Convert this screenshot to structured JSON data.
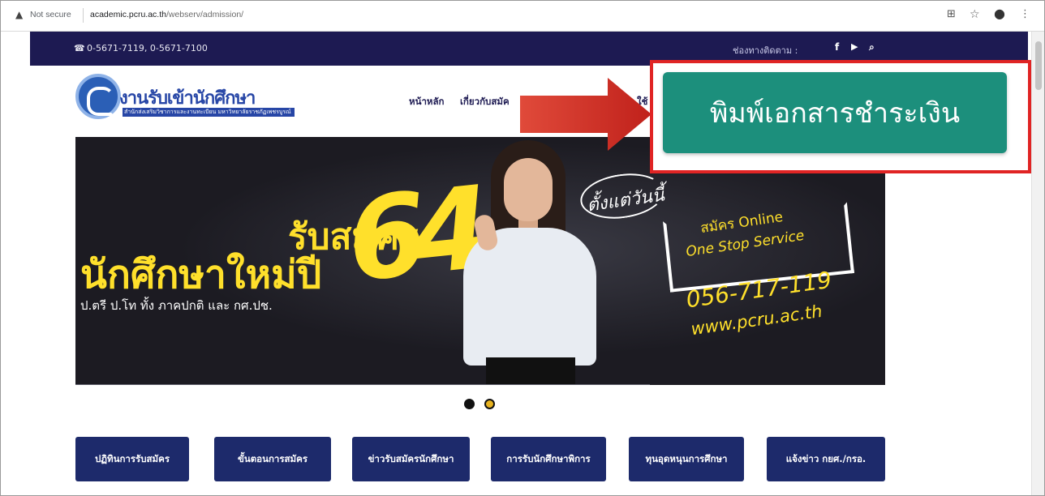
{
  "browser": {
    "security_warning": "Not secure",
    "url_host": "academic.pcru.ac.th",
    "url_path": "/webserv/admission/"
  },
  "topbar": {
    "phone": "0-5671-7119, 0-5671-7100",
    "follow_label": "ช่องทางติดตาม :"
  },
  "header": {
    "logo_title": "งานรับเข้านักศึกษา",
    "logo_subtitle": "สำนักส่งเสริมวิชาการและงานทะเบียน มหาวิทยาลัยราชภัฏเพชรบูรณ์",
    "nav": {
      "home": "หน้าหลัก",
      "apply": "เกี่ยวกับสมัค",
      "partial": "ใช้"
    }
  },
  "highlight": {
    "print_payment_button": "พิมพ์เอกสารชำระเงิน"
  },
  "banner": {
    "line1": "รับสมัคร",
    "line2": "นักศึกษาใหม่ปี",
    "year": "64",
    "line3": "ป.ตรี ป.โท ทั้ง ภาคปกติ และ กศ.ปช.",
    "since": "ตั้งแต่วันนี้",
    "online": "สมัคร Online",
    "service": "One Stop Service",
    "tel": "056-717-119",
    "web": "www.pcru.ac.th"
  },
  "quick_links": [
    "ปฏิทินการรับสมัคร",
    "ขั้นตอนการสมัคร",
    "ข่าวรับสมัครนักศึกษา",
    "การรับนักศึกษาพิการ",
    "ทุนอุดหนุนการศึกษา",
    "แจ้งข่าว กยศ./กรอ."
  ],
  "colors": {
    "topbar": "#1d1a52",
    "highlight_button": "#1c8f7c",
    "highlight_border": "#e02424",
    "banner_text": "#ffe02b",
    "quick_link_bg": "#1d2a6b"
  },
  "icons": [
    "warning-icon",
    "phone-icon",
    "facebook-icon",
    "youtube-icon",
    "search-icon",
    "translate-icon",
    "star-icon",
    "account-icon",
    "menu-icon"
  ]
}
